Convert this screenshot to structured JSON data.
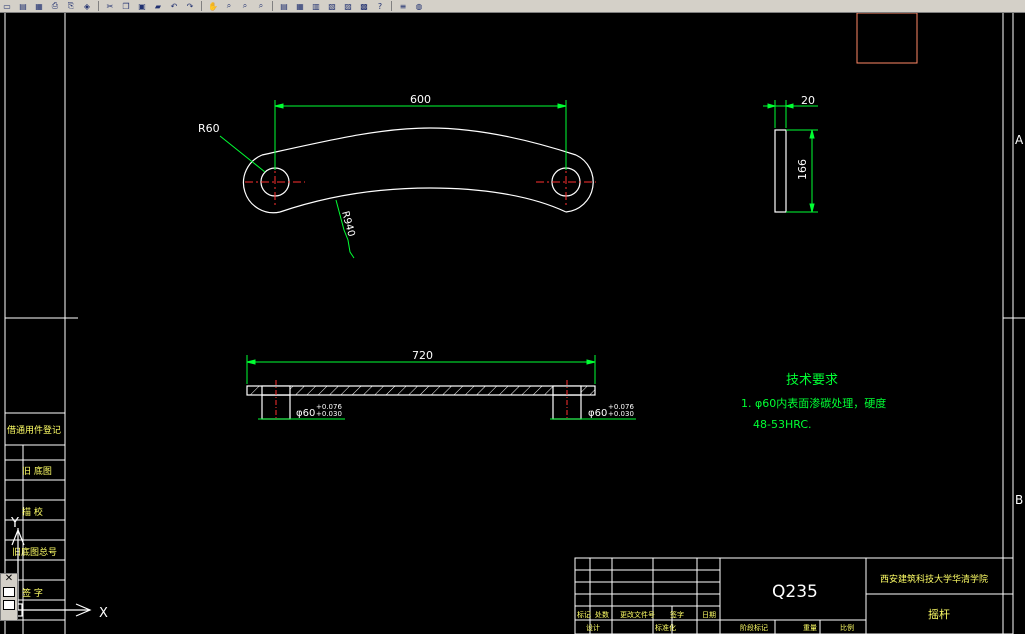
{
  "toolbar": {
    "icons": [
      "new-icon",
      "open-icon",
      "save-icon",
      "print-icon",
      "preview-icon",
      "publish-icon",
      "cut-icon",
      "copy-icon",
      "paste-icon",
      "match-icon",
      "undo-icon",
      "redo-icon",
      "pan-icon",
      "zoom-realtime-icon",
      "zoom-window-icon",
      "zoom-previous-icon",
      "properties-icon",
      "designcenter-icon",
      "toolpalette-icon",
      "sheetset-icon",
      "markup-icon",
      "calc-icon",
      "help-icon",
      "layer-icon",
      "layer-state-icon"
    ],
    "glyphs": [
      "▭",
      "▤",
      "▦",
      "⎙",
      "⎘",
      "◈",
      "✂",
      "❐",
      "▣",
      "▰",
      "↶",
      "↷",
      "✋",
      "⌕",
      "⌕",
      "⌕",
      "▤",
      "▦",
      "▥",
      "▧",
      "▨",
      "▩",
      "?",
      "≡",
      "◍"
    ]
  },
  "drawing": {
    "colors": {
      "outline": "#ffffff",
      "dim": "#00ff33",
      "center": "#ff3030",
      "hatch": "#ffffff",
      "title_block": "#ffffff",
      "note": "#00ff33",
      "tag": "#ffff66"
    },
    "dims": {
      "top_length": "600",
      "radius_end": "R60",
      "radius_arc": "R940",
      "thickness": "20",
      "height": "166",
      "total_length": "720",
      "bore_left": "φ60",
      "bore_left_tol_upper": "+0.076",
      "bore_left_tol_lower": "+0.030",
      "bore_right": "φ60",
      "bore_right_tol_upper": "+0.076",
      "bore_right_tol_lower": "+0.030"
    },
    "tech_req": {
      "title": "技术要求",
      "line1": "1. φ60内表面渗碳处理，硬度",
      "line2": "48-53HRC."
    },
    "border_labels": {
      "zone_a": "A",
      "zone_b": "B"
    },
    "left_strip": {
      "row1": "借通用件登记",
      "row2": "旧 底图",
      "row3": "描 校",
      "row4": "旧底图总号",
      "row5": "签 字"
    },
    "title_block": {
      "material": "Q235",
      "school": "西安建筑科技大学华清学院",
      "part_name": "摇杆",
      "labels": {
        "mark": "标记",
        "count": "处数",
        "change_doc": "更改文件号",
        "sign": "签字",
        "date": "日期",
        "design": "设计",
        "standard": "标准化",
        "stage_mark": "阶段标记",
        "weight": "重量",
        "scale": "比例"
      }
    },
    "ucs": {
      "x_label": "X",
      "y_label": "Y"
    }
  }
}
